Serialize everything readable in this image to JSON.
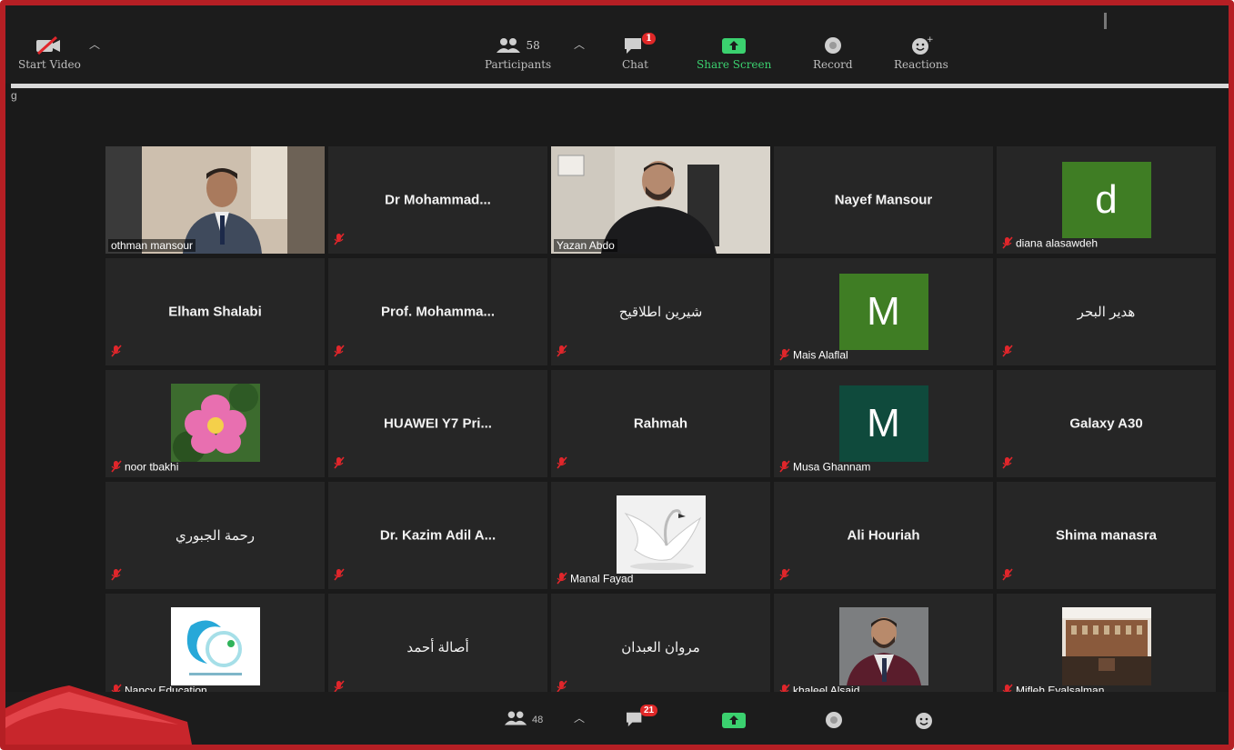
{
  "toolbar": {
    "start_video_label": "Start Video",
    "participants_count": "58",
    "participants_label": "Participants",
    "chat_badge": "1",
    "chat_label": "Chat",
    "share_screen_label": "Share Screen",
    "record_label": "Record",
    "reactions_label": "Reactions",
    "side_fragment": "g"
  },
  "colors": {
    "accent_green": "#3bd16f",
    "active_speaker_border": "#d8e35a",
    "frame_border": "#b51f24",
    "mute_red": "#e0262b"
  },
  "tiles": [
    {
      "name": "othman mansour",
      "type": "video"
    },
    {
      "name": "Dr  Mohammad..."
    },
    {
      "name": "Yazan Abdo",
      "type": "video"
    },
    {
      "name": "Nayef Mansour"
    },
    {
      "name": "diana alasawdeh",
      "initial": "d",
      "color": "#3f7d24"
    },
    {
      "name": "Elham Shalabi"
    },
    {
      "name": "Prof.  Mohamma..."
    },
    {
      "name": "شيرين اطلاقيح"
    },
    {
      "name": "Mais Alaflal",
      "initial": "M",
      "color": "#3f7d24"
    },
    {
      "name": "هدير البحر"
    },
    {
      "name": "noor tbakhi",
      "type": "flower"
    },
    {
      "name": "HUAWEI  Y7 Pri..."
    },
    {
      "name": "Rahmah"
    },
    {
      "name": "Musa Ghannam",
      "initial": "M",
      "color": "#0f4a3c"
    },
    {
      "name": "Galaxy A30"
    },
    {
      "name": "رحمة الجبوري"
    },
    {
      "name": "Dr.  Kazim  Adil  A..."
    },
    {
      "name": "Manal Fayad",
      "type": "swan"
    },
    {
      "name": "Ali Houriah"
    },
    {
      "name": "Shima manasra"
    },
    {
      "name": "Nancy Education...",
      "type": "logo"
    },
    {
      "name": "أصالة أحمد"
    },
    {
      "name": "مروان العبدان"
    },
    {
      "name": "khaleel Alsaid",
      "type": "portrait"
    },
    {
      "name": "Mifleh Eyalsalman",
      "type": "building"
    }
  ],
  "bottombar": {
    "participants_count": "48",
    "chat_badge": "21"
  }
}
